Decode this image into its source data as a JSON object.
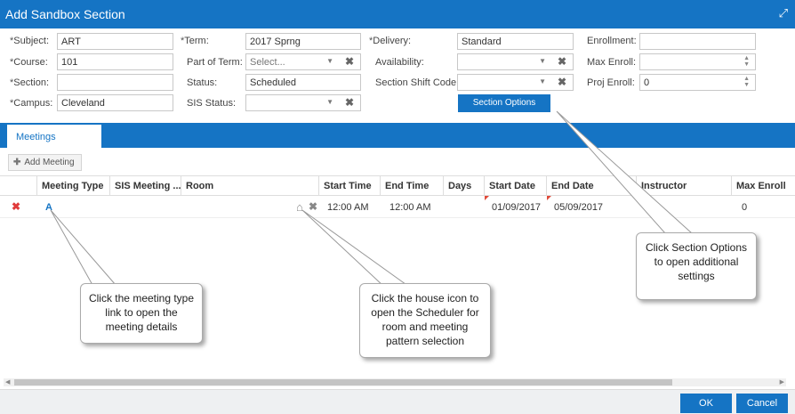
{
  "window": {
    "title": "Add Sandbox Section",
    "expand_icon": "expand-icon"
  },
  "form": {
    "subject": {
      "label": "Subject:",
      "value": "ART",
      "required": "*"
    },
    "course": {
      "label": "Course:",
      "value": "101",
      "required": "*"
    },
    "section": {
      "label": "Section:",
      "value": "",
      "required": "*"
    },
    "campus": {
      "label": "Campus:",
      "value": "Cleveland",
      "required": "*"
    },
    "term": {
      "label": "Term:",
      "value": "2017 Sprng",
      "required": "*"
    },
    "part_of_term": {
      "label": "Part of Term:",
      "value": "Select..."
    },
    "status": {
      "label": "Status:",
      "value": "Scheduled"
    },
    "sis_status": {
      "label": "SIS Status:",
      "value": ""
    },
    "delivery": {
      "label": "Delivery:",
      "value": "Standard",
      "required": "*"
    },
    "availability": {
      "label": "Availability:",
      "value": ""
    },
    "section_shift_code": {
      "label": "Section Shift Code:",
      "value": ""
    },
    "section_options_button": "Section Options",
    "enrollment": {
      "label": "Enrollment:",
      "value": ""
    },
    "max_enroll": {
      "label": "Max Enroll:",
      "value": ""
    },
    "proj_enroll": {
      "label": "Proj Enroll:",
      "value": "0"
    }
  },
  "tabs": [
    {
      "label": "Meetings"
    }
  ],
  "toolbar": {
    "add_meeting": "Add Meeting"
  },
  "grid": {
    "columns": [
      "Meeting Type",
      "SIS Meeting ...",
      "Room",
      "Start Time",
      "End Time",
      "Days",
      "Start Date",
      "End Date",
      "Instructor",
      "Max Enroll"
    ],
    "rows": [
      {
        "meeting_type": "A",
        "sis_meeting": "",
        "room": "",
        "start_time": "12:00 AM",
        "end_time": "12:00 AM",
        "days": "",
        "start_date": "01/09/2017",
        "end_date": "05/09/2017",
        "instructor": "",
        "max_enroll": "0"
      }
    ]
  },
  "callouts": {
    "meeting_type": "Click the meeting type link to open the meeting details",
    "house_icon": "Click the house icon to open the Scheduler for room and meeting pattern selection",
    "section_options": "Click Section Options to open additional settings"
  },
  "footer": {
    "ok": "OK",
    "cancel": "Cancel"
  },
  "colors": {
    "accent": "#1574c4",
    "delete": "#e03b3b"
  }
}
